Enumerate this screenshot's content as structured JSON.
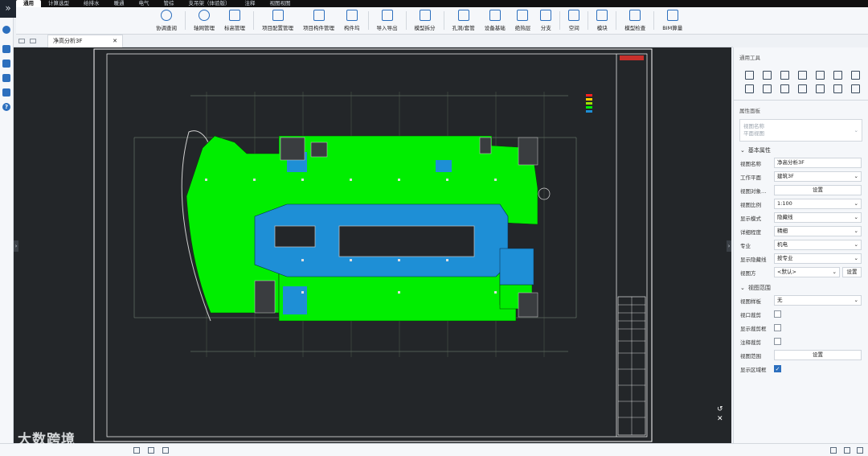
{
  "menu_tabs": [
    "通用",
    "计算选型",
    "给排水",
    "暖通",
    "电气",
    "管综",
    "支吊架（体验版）",
    "注释",
    "视图视图"
  ],
  "ribbon": [
    {
      "label": "协调查阅",
      "icon": "binoculars-icon"
    },
    {
      "label": "轴网管理",
      "icon": "axis-grid-icon"
    },
    {
      "label": "标高管理",
      "icon": "elevation-icon"
    },
    {
      "label": "项目配置管理",
      "icon": "config-icon"
    },
    {
      "label": "项目构件管理",
      "icon": "component-icon"
    },
    {
      "label": "构件坞",
      "icon": "dock-icon"
    },
    {
      "label": "导入导出",
      "icon": "import-export-icon"
    },
    {
      "label": "模型拆分",
      "icon": "split-icon"
    },
    {
      "label": "孔洞/套管",
      "icon": "hole-icon"
    },
    {
      "label": "设备基础",
      "icon": "equipment-base-icon"
    },
    {
      "label": "绝热层",
      "icon": "insulation-icon"
    },
    {
      "label": "分支",
      "icon": "branch-icon"
    },
    {
      "label": "空间",
      "icon": "space-icon"
    },
    {
      "label": "模块",
      "icon": "module-icon"
    },
    {
      "label": "模型检查",
      "icon": "model-check-icon"
    },
    {
      "label": "BIM算量",
      "icon": "bim-quantity-icon"
    }
  ],
  "doc_tab": {
    "title": "净高分析3F"
  },
  "right_panel": {
    "tools_title": "通用工具",
    "tool_icons": [
      "move-icon",
      "align-icon",
      "rotate-icon",
      "offset-icon",
      "split-element-icon",
      "copy-icon",
      "array-icon",
      "trim-icon",
      "extend-icon",
      "stair-icon",
      "mirror-icon",
      "delete-icon",
      "measure-icon",
      "pick-icon"
    ],
    "props_title": "属性面板",
    "view_picker": {
      "name_line": "视图名称",
      "type_line": "平面视图"
    },
    "basic_group": "基本属性",
    "rows": [
      {
        "label": "视图名称",
        "value": "净高分析3F",
        "kind": "text"
      },
      {
        "label": "工作平面",
        "value": "建筑3F",
        "kind": "select"
      },
      {
        "label": "视图对象…",
        "value": "设置",
        "kind": "button"
      },
      {
        "label": "视图比例",
        "value": "1:100",
        "kind": "select"
      },
      {
        "label": "显示模式",
        "value": "隐藏线",
        "kind": "select"
      },
      {
        "label": "详细程度",
        "value": "精细",
        "kind": "select"
      },
      {
        "label": "专业",
        "value": "机电",
        "kind": "select"
      },
      {
        "label": "显示隐藏线",
        "value": "按专业",
        "kind": "select"
      },
      {
        "label": "视图方",
        "value": "<默认>",
        "kind": "select-btn",
        "button": "设置"
      }
    ],
    "range_group": "视图范围",
    "range_rows": [
      {
        "label": "视图样板",
        "value": "无",
        "kind": "select"
      },
      {
        "label": "视口裁剪",
        "kind": "check",
        "checked": false
      },
      {
        "label": "显示裁剪框",
        "kind": "check",
        "checked": false
      },
      {
        "label": "注释裁剪",
        "kind": "check",
        "checked": false
      },
      {
        "label": "视图范围",
        "value": "设置",
        "kind": "button"
      },
      {
        "label": "显示区域框",
        "kind": "check",
        "checked": true
      }
    ]
  },
  "watermark": "大数跨境",
  "colors": {
    "accent": "#2c6fbe",
    "zone_green": "#00ee00",
    "zone_blue": "#1e8fd6",
    "canvas": "#232629"
  }
}
